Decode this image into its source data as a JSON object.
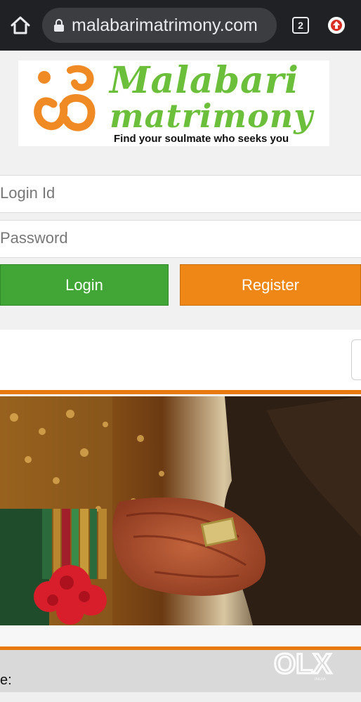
{
  "browser": {
    "url": "malabarimatrimony.com",
    "tab_count": "2",
    "icons": [
      "home-icon",
      "lock-icon",
      "tabs-icon",
      "update-icon"
    ]
  },
  "logo": {
    "title_line1": "Malabari",
    "title_line2": "matrimony",
    "tagline": "Find your soulmate who seeks you",
    "colors": {
      "mark": "#f08a24",
      "text": "#6cbf3a"
    }
  },
  "login": {
    "login_id_placeholder": "Login Id",
    "password_placeholder": "Password",
    "login_button": "Login",
    "register_button": "Register"
  },
  "section": {
    "label": "e:"
  },
  "watermark": {
    "text": "OLX",
    "sub": "INDIA"
  },
  "colors": {
    "login_green": "#42a636",
    "register_orange": "#ee8716",
    "accent_orange": "#e8790e"
  }
}
